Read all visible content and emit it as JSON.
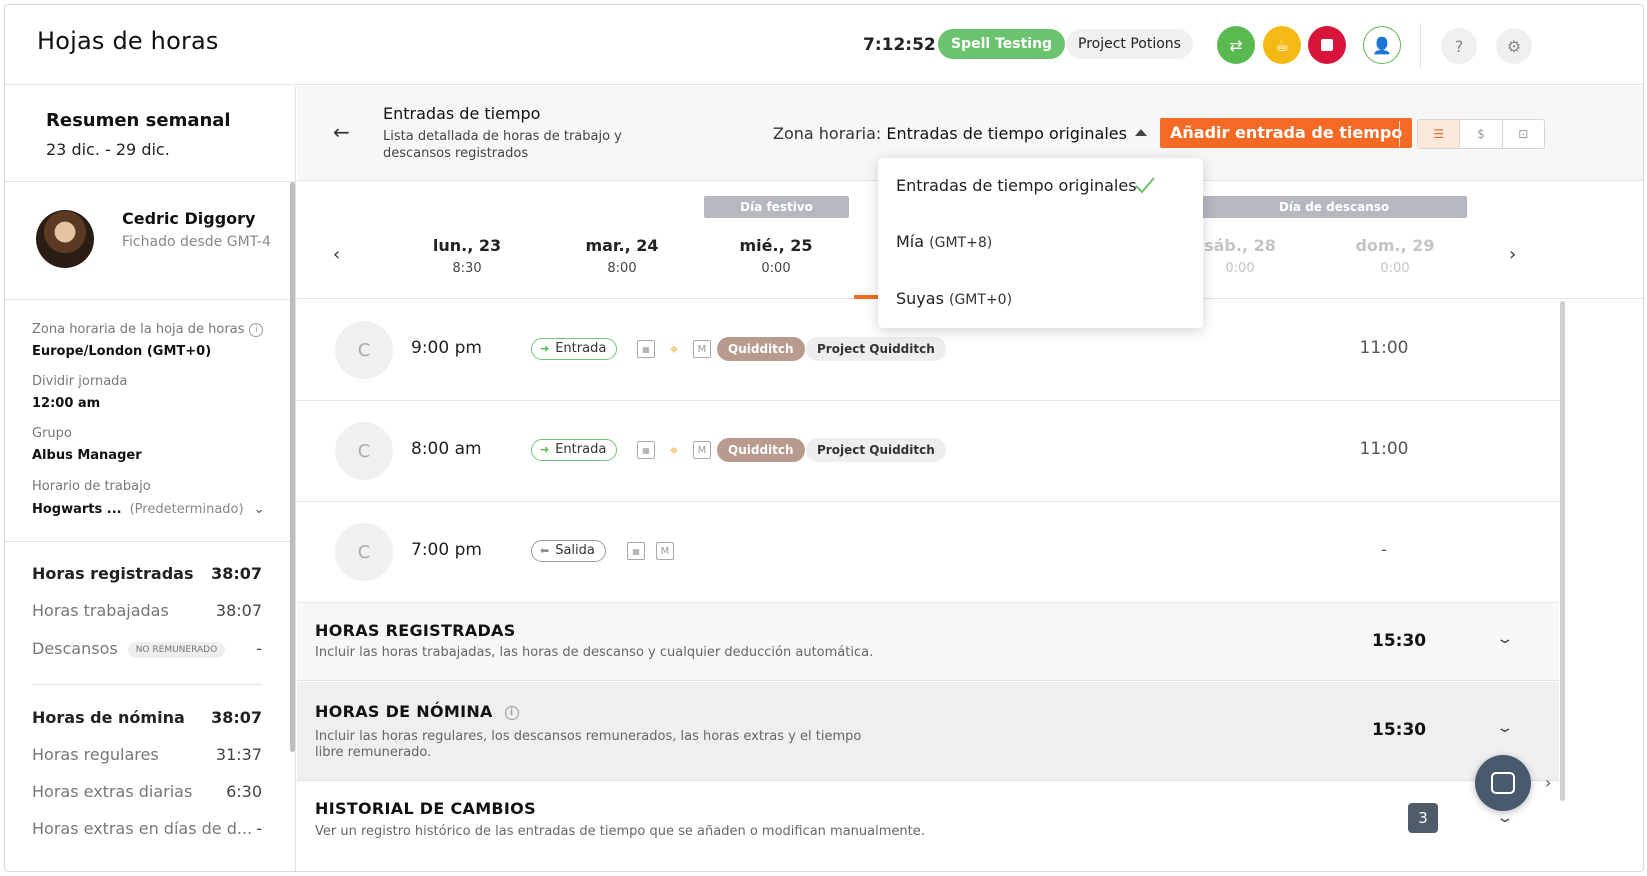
{
  "header": {
    "title": "Hojas de horas",
    "clock": "7:12:52",
    "activity": "Spell Testing",
    "project": "Project Potions"
  },
  "summary": {
    "title": "Resumen semanal",
    "range": "23 dic. - 29 dic."
  },
  "employee": {
    "name": "Cedric Diggory",
    "clocked_from": "Fichado desde GMT-4"
  },
  "details": {
    "tz_label": "Zona horaria de la hoja de horas",
    "tz_value": "Europe/London (GMT+0)",
    "split_label": "Dividir jornada",
    "split_value": "12:00 am",
    "group_label": "Grupo",
    "group_value": "Albus Manager",
    "schedule_label": "Horario de trabajo",
    "schedule_value": "Hogwarts ...",
    "schedule_default": "(Predeterminado)"
  },
  "totals": {
    "tracked_label": "Horas registradas",
    "tracked_value": "38:07",
    "worked_label": "Horas trabajadas",
    "worked_value": "38:07",
    "breaks_label": "Descansos",
    "breaks_badge": "NO REMUNERADO",
    "breaks_value": "-",
    "payroll_label": "Horas de nómina",
    "payroll_value": "38:07",
    "regular_label": "Horas regulares",
    "regular_value": "31:37",
    "daily_ot_label": "Horas extras diarias",
    "daily_ot_value": "6:30",
    "restday_ot_label": "Horas extras en días de d...",
    "restday_ot_value": "-"
  },
  "main": {
    "title": "Entradas de tiempo",
    "subtitle": "Lista detallada de horas de trabajo y descansos registrados",
    "tz_prefix": "Zona horaria:",
    "tz_selected": "Entradas de tiempo originales",
    "add_button": "Añadir entrada de tiempo"
  },
  "days": {
    "holiday_badge": "Día festivo",
    "rest_badge": "Día de descanso",
    "items": [
      {
        "name": "lun., 23",
        "hours": "8:30"
      },
      {
        "name": "mar., 24",
        "hours": "8:00"
      },
      {
        "name": "mié., 25",
        "hours": "0:00"
      },
      {
        "name": "sáb., 28",
        "hours": "0:00"
      },
      {
        "name": "dom., 29",
        "hours": "0:00"
      }
    ]
  },
  "dropdown": {
    "options": [
      {
        "label": "Entradas de tiempo originales",
        "gmt": "",
        "selected": true
      },
      {
        "label": "Mía",
        "gmt": "(GMT+8)",
        "selected": false
      },
      {
        "label": "Suyas",
        "gmt": "(GMT+0)",
        "selected": false
      }
    ]
  },
  "entries": [
    {
      "initial": "C",
      "time": "9:00 pm",
      "type": "Entrada",
      "activity": "Quidditch",
      "project": "Project Quidditch",
      "duration": "11:00"
    },
    {
      "initial": "C",
      "time": "8:00 am",
      "type": "Entrada",
      "activity": "Quidditch",
      "project": "Project Quidditch",
      "duration": "11:00"
    },
    {
      "initial": "C",
      "time": "7:00 pm",
      "type": "Salida",
      "activity": "",
      "project": "",
      "duration": "-"
    }
  ],
  "sections": {
    "tracked_title": "HORAS REGISTRADAS",
    "tracked_sub": "Incluir las horas trabajadas, las horas de descanso y cualquier deducción automática.",
    "tracked_value": "15:30",
    "payroll_title": "HORAS DE NÓMINA",
    "payroll_sub": "Incluir las horas regulares, los descansos remunerados, las horas extras y el tiempo libre remunerado.",
    "payroll_value": "15:30",
    "history_title": "HISTORIAL DE CAMBIOS",
    "history_sub": "Ver un registro histórico de las entradas de tiempo que se añaden o modifican manualmente."
  },
  "chat": {
    "badge": "3"
  },
  "colors": {
    "accent": "#f46a25",
    "green": "#6cc36e",
    "red": "#d8143a",
    "yellow": "#f5b915",
    "activity_tag": "#b99a8e"
  }
}
